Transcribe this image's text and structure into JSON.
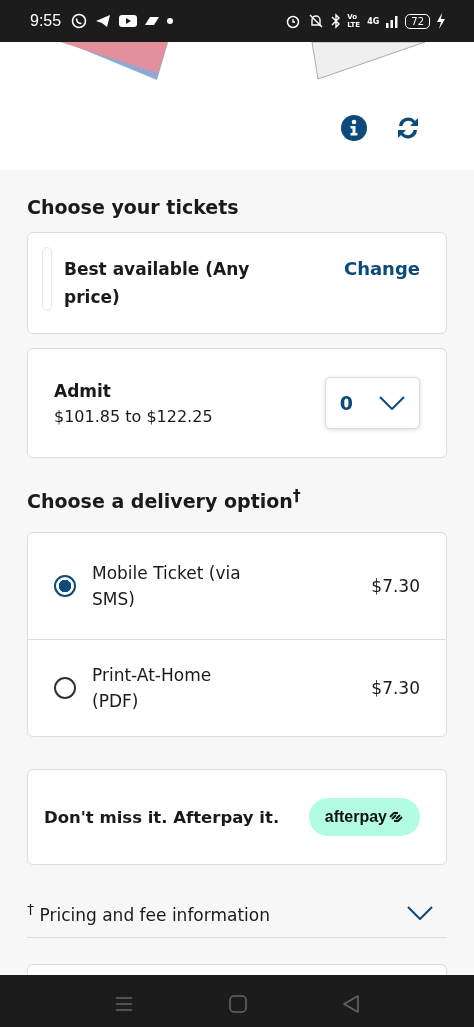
{
  "status_bar": {
    "time": "9:55",
    "volte": "Vo LTE",
    "network": "4G",
    "battery": "72"
  },
  "tickets": {
    "heading": "Choose your tickets",
    "selection": {
      "label": "Best available (Any price)",
      "action": "Change"
    },
    "admit": {
      "label": "Admit",
      "price_range": "$101.85 to $122.25",
      "quantity": "0"
    }
  },
  "delivery": {
    "heading": "Choose a delivery option$^{†}$",
    "options": [
      {
        "label": "Mobile Ticket (via SMS)",
        "price": "$7.30",
        "selected": true
      },
      {
        "label": "Print-At-Home (PDF)",
        "price": "$7.30",
        "selected": false
      }
    ]
  },
  "afterpay": {
    "text": "Don't miss it. Afterpay it.",
    "badge": "afterpay"
  },
  "pricing_info": {
    "label": "$^{†}$ Pricing and fee information",
    "expanded": false
  }
}
